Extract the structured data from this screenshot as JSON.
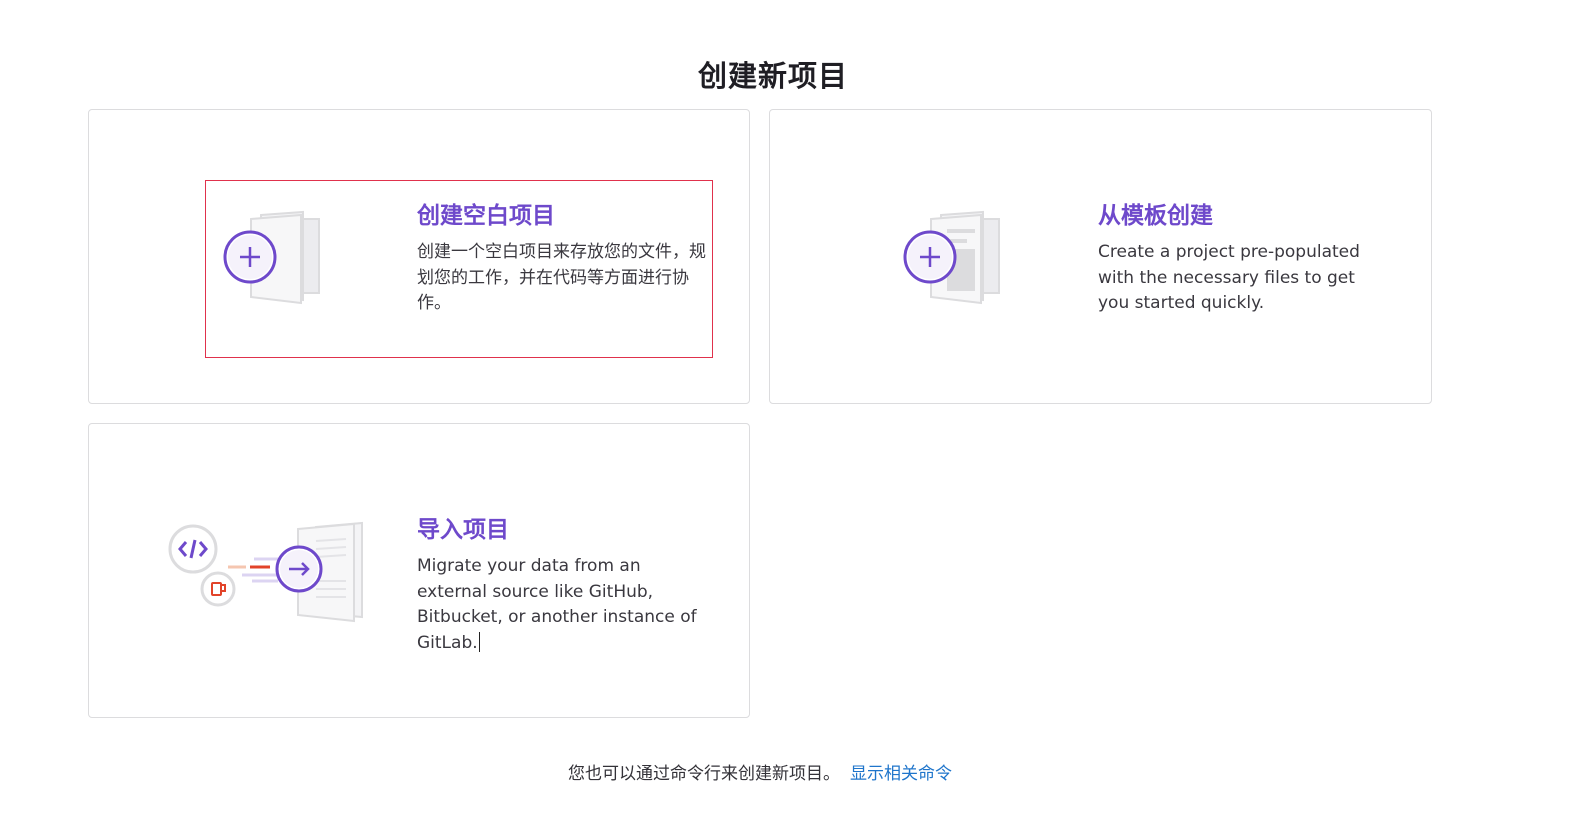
{
  "page": {
    "title": "创建新项目"
  },
  "cards": {
    "blank": {
      "title": "创建空白项目",
      "description": "创建一个空白项目来存放您的文件，规划您的工作，并在代码等方面进行协作。",
      "icon": "blank-project-illustration"
    },
    "template": {
      "title": "从模板创建",
      "description": "Create a project pre-populated with the necessary files to get you started quickly.",
      "icon": "template-project-illustration"
    },
    "import": {
      "title": "导入项目",
      "description": "Migrate your data from an external source like GitHub, Bitbucket, or another instance of GitLab.",
      "icon": "import-project-illustration"
    }
  },
  "footer": {
    "text": "您也可以通过命令行来创建新项目。",
    "link": "显示相关命令"
  },
  "colors": {
    "accent": "#6e49cb",
    "link": "#1f75cb",
    "focus_outline": "#e0314c",
    "import_orange": "#e24329"
  }
}
